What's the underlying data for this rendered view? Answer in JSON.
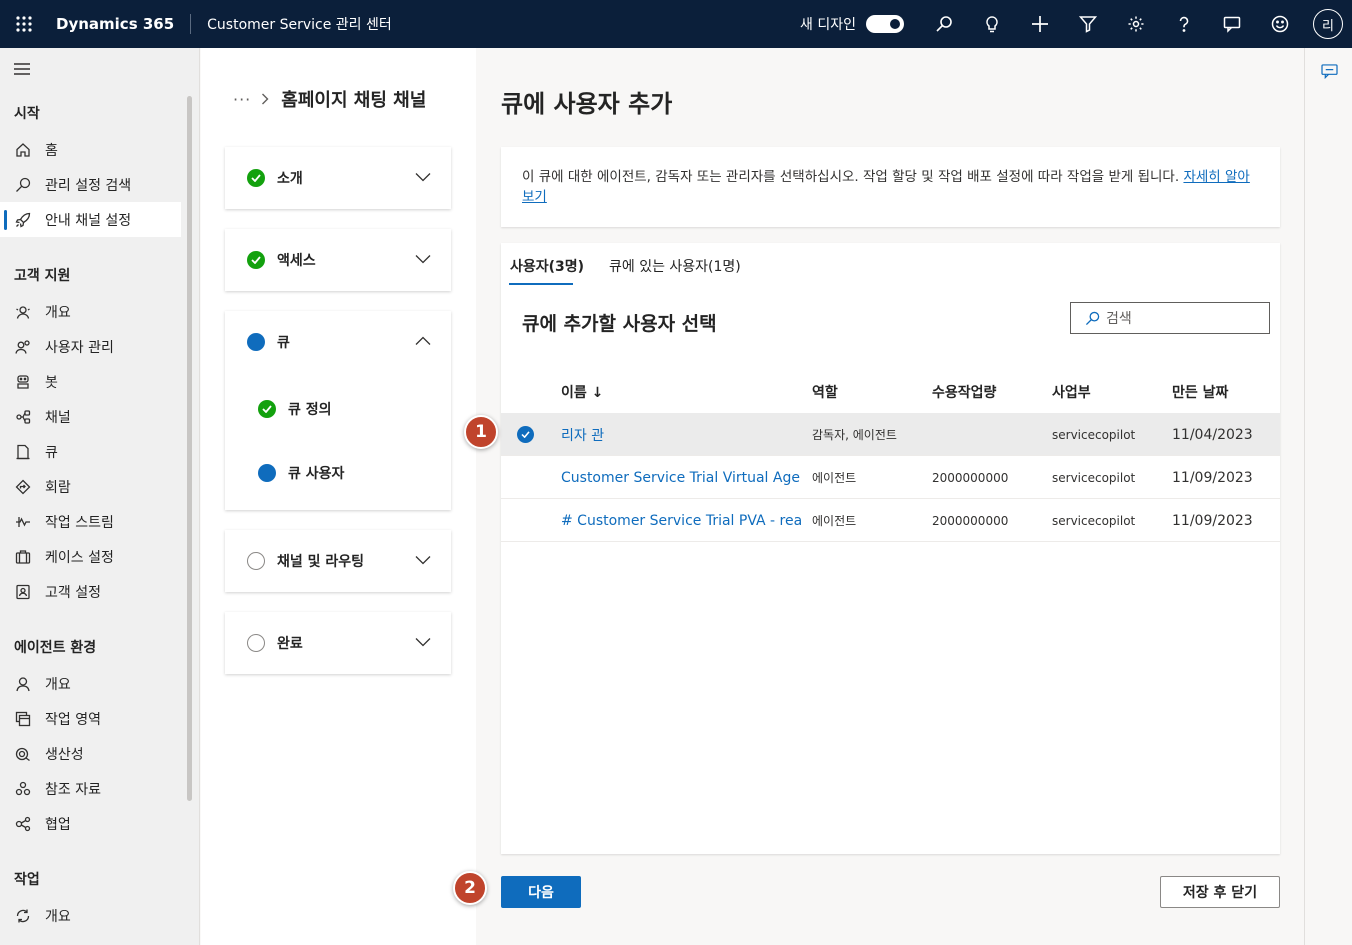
{
  "topbar": {
    "app_name": "Dynamics 365",
    "area_name": "Customer Service 관리 센터",
    "new_design_label": "새 디자인",
    "avatar_initial": "리",
    "icons": [
      "search-icon",
      "lightbulb-icon",
      "plus-icon",
      "filter-icon",
      "settings-icon",
      "help-icon",
      "feedback-icon",
      "smiley-icon"
    ]
  },
  "nav": {
    "groups": [
      {
        "title": "시작",
        "items": [
          {
            "label": "홈",
            "icon": "home-icon"
          },
          {
            "label": "관리 설정 검색",
            "icon": "search-icon"
          },
          {
            "label": "안내 채널 설정",
            "icon": "rocket-icon",
            "active": true
          }
        ]
      },
      {
        "title": "고객 지원",
        "items": [
          {
            "label": "개요",
            "icon": "overview-icon"
          },
          {
            "label": "사용자 관리",
            "icon": "people-icon"
          },
          {
            "label": "봇",
            "icon": "bot-icon"
          },
          {
            "label": "채널",
            "icon": "channel-icon"
          },
          {
            "label": "큐",
            "icon": "queue-icon"
          },
          {
            "label": "회람",
            "icon": "routing-icon"
          },
          {
            "label": "작업 스트림",
            "icon": "workstream-icon"
          },
          {
            "label": "케이스 설정",
            "icon": "briefcase-icon"
          },
          {
            "label": "고객 설정",
            "icon": "contact-card-icon"
          }
        ]
      },
      {
        "title": "에이전트 환경",
        "items": [
          {
            "label": "개요",
            "icon": "person-icon"
          },
          {
            "label": "작업 영역",
            "icon": "workspace-icon"
          },
          {
            "label": "생산성",
            "icon": "productivity-icon"
          },
          {
            "label": "참조 자료",
            "icon": "knowledge-icon"
          },
          {
            "label": "협업",
            "icon": "collaborate-icon"
          }
        ]
      },
      {
        "title": "작업",
        "items": [
          {
            "label": "개요",
            "icon": "sync-icon"
          }
        ]
      }
    ]
  },
  "wizard": {
    "breadcrumb_dots": "···",
    "breadcrumb_title": "홈페이지 채팅 채널",
    "steps": [
      {
        "label": "소개",
        "status": "done"
      },
      {
        "label": "액세스",
        "status": "done"
      },
      {
        "label": "큐",
        "status": "current",
        "substeps": [
          {
            "label": "큐 정의",
            "status": "done"
          },
          {
            "label": "큐 사용자",
            "status": "current"
          }
        ]
      },
      {
        "label": "채널 및 라우팅",
        "status": "todo"
      },
      {
        "label": "완료",
        "status": "todo"
      }
    ]
  },
  "main": {
    "title": "큐에 사용자 추가",
    "info_text": "이 큐에 대한 에이전트, 감독자 또는 관리자를 선택하십시오. 작업 할당 및 작업 배포 설정에 따라 작업을 받게 됩니다.",
    "info_link": "자세히 알아보기",
    "tabs": [
      {
        "label": "사용자(3명)",
        "selected": true
      },
      {
        "label": "큐에 있는 사용자(1명)",
        "selected": false
      }
    ],
    "panel_title": "큐에 추가할 사용자 선택",
    "search_placeholder": "검색",
    "columns": [
      "이름 ↓",
      "역할",
      "수용작업량",
      "사업부",
      "만든 날짜"
    ],
    "rows": [
      {
        "name": "리자 관",
        "role": "감독자, 에이전트",
        "capacity": "",
        "bu": "servicecopilot",
        "created": "11/04/2023",
        "selected": true
      },
      {
        "name": "Customer Service Trial Virtual Agent Cu",
        "role": "에이전트",
        "capacity": "2000000000",
        "bu": "servicecopilot",
        "created": "11/09/2023",
        "selected": false
      },
      {
        "name": "# Customer Service Trial PVA - readonly",
        "role": "에이전트",
        "capacity": "2000000000",
        "bu": "servicecopilot",
        "created": "11/09/2023",
        "selected": false
      }
    ],
    "next_label": "다음",
    "save_close_label": "저장 후 닫기"
  },
  "callouts": [
    "1",
    "2"
  ],
  "colors": {
    "topbar": "#0b1f3a",
    "accent": "#0f6cbd",
    "success": "#13a10e",
    "callout": "#c0442c"
  }
}
